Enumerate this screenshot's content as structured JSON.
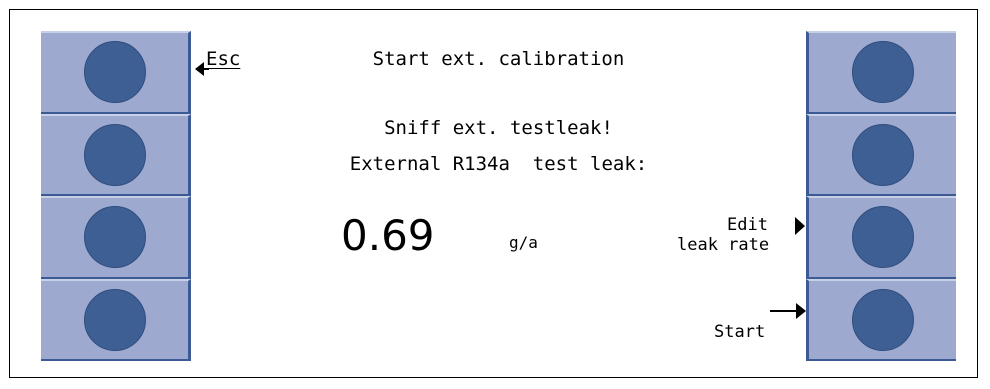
{
  "screen": {
    "esc_label": "Esc",
    "title": "Start ext. calibration",
    "instruction": "Sniff ext. testleak!",
    "leak_label": "External R134a  test leak:",
    "leak_value": "0.69",
    "leak_unit": "g/a",
    "edit_label_line1": "Edit",
    "edit_label_line2": "leak rate",
    "start_label": "Start"
  },
  "colors": {
    "key_bg": "#9da9ce",
    "key_circle": "#3e5f94",
    "screen_bg": "#ffffff"
  }
}
